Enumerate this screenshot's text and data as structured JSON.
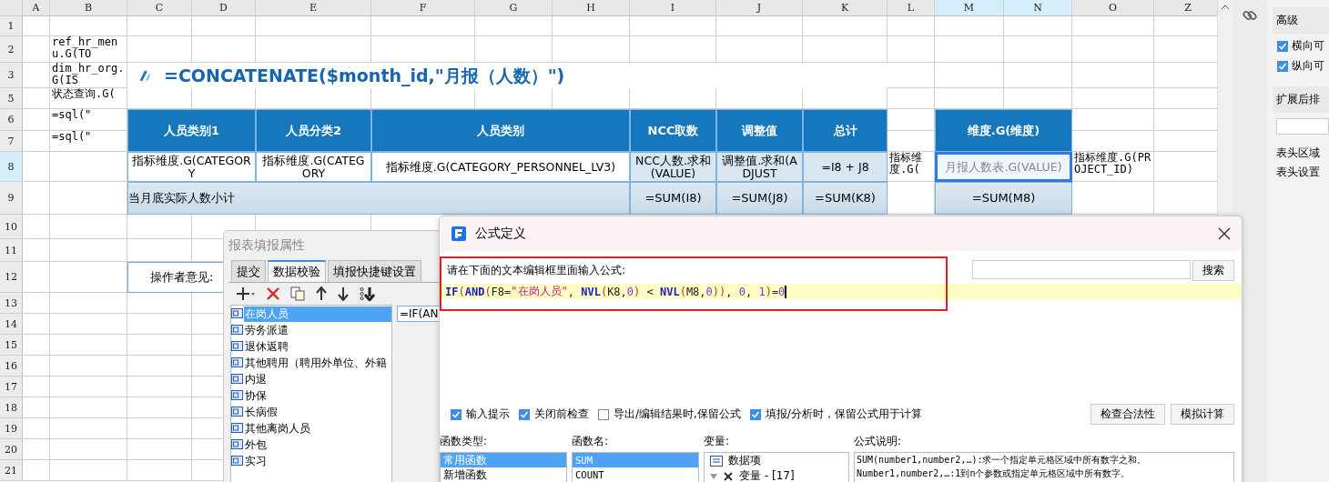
{
  "sheet": {
    "columns": [
      {
        "label": "A",
        "selected": false
      },
      {
        "label": "B",
        "selected": false
      },
      {
        "label": "C",
        "selected": false
      },
      {
        "label": "D",
        "selected": false
      },
      {
        "label": "E",
        "selected": false
      },
      {
        "label": "F",
        "selected": false
      },
      {
        "label": "G",
        "selected": false
      },
      {
        "label": "H",
        "selected": false
      },
      {
        "label": "I",
        "selected": false
      },
      {
        "label": "J",
        "selected": false
      },
      {
        "label": "K",
        "selected": false
      },
      {
        "label": "L",
        "selected": false
      },
      {
        "label": "M",
        "selected": true
      },
      {
        "label": "N",
        "selected": true
      },
      {
        "label": "O",
        "selected": false
      },
      {
        "label": "Z",
        "selected": false
      }
    ],
    "rows": [
      {
        "label": "1",
        "selected": false
      },
      {
        "label": "2",
        "selected": false
      },
      {
        "label": "3",
        "selected": false
      },
      {
        "label": "5",
        "selected": false
      },
      {
        "label": "6",
        "selected": false
      },
      {
        "label": "7",
        "selected": false
      },
      {
        "label": "8",
        "selected": true
      },
      {
        "label": "9",
        "selected": false
      },
      {
        "label": "10",
        "selected": false
      },
      {
        "label": "11",
        "selected": false
      },
      {
        "label": "12",
        "selected": false
      },
      {
        "label": "13",
        "selected": false
      },
      {
        "label": "14",
        "selected": false
      },
      {
        "label": "15",
        "selected": false
      },
      {
        "label": "16",
        "selected": false
      },
      {
        "label": "17",
        "selected": false
      },
      {
        "label": "18",
        "selected": false
      },
      {
        "label": "19",
        "selected": false
      },
      {
        "label": "20",
        "selected": false
      },
      {
        "label": "21",
        "selected": false
      }
    ],
    "cells": [
      {
        "kind": "code",
        "text": "ref_hr_menu.G(TO",
        "selected": false
      },
      {
        "kind": "code",
        "text": "dim_hr_org.G(IS",
        "selected": false
      },
      {
        "kind": "title",
        "text": "=CONCATENATE($month_id,\"月报（人数）\")",
        "selected": false
      },
      {
        "kind": "code",
        "text": "状态查询.G(",
        "selected": false
      },
      {
        "kind": "code",
        "text": "=sql(\"",
        "selected": false
      },
      {
        "kind": "code",
        "text": "=sql(\"",
        "selected": false
      },
      {
        "kind": "header",
        "text": "人员类别1",
        "selected": false
      },
      {
        "kind": "header",
        "text": "人员分类2",
        "selected": false
      },
      {
        "kind": "header",
        "text": "人员类别",
        "selected": false
      },
      {
        "kind": "header",
        "text": "NCC取数",
        "selected": false
      },
      {
        "kind": "header",
        "text": "调整值",
        "selected": false
      },
      {
        "kind": "header",
        "text": "总计",
        "selected": false
      },
      {
        "kind": "header",
        "text": "维度.G(维度)",
        "selected": false
      },
      {
        "kind": "data",
        "text": "指标维度.G(CATEGORY",
        "selected": false
      },
      {
        "kind": "data",
        "text": "指标维度.G(CATEGORY",
        "selected": false
      },
      {
        "kind": "data",
        "text": "指标维度.G(CATEGORY_PERSONNEL_LV3)",
        "selected": false
      },
      {
        "kind": "calc",
        "text": "NCC人数.求和(VALUE)",
        "selected": false
      },
      {
        "kind": "calc",
        "text": "调整值.求和(ADJUST",
        "selected": false
      },
      {
        "kind": "calc",
        "text": "=I8 + J8",
        "selected": false
      },
      {
        "kind": "code",
        "text": "指标维度.G(",
        "selected": false
      },
      {
        "kind": "calc",
        "text": "月报人数表.G(VALUE)",
        "selected": true
      },
      {
        "kind": "code",
        "text": "指标维度.G(PROJECT_ID)",
        "selected": false
      },
      {
        "kind": "subtotal_label",
        "text": "当月底实际人数小计",
        "selected": false
      },
      {
        "kind": "subtotal",
        "text": "=SUM(I8)",
        "selected": false
      },
      {
        "kind": "subtotal",
        "text": "=SUM(J8)",
        "selected": false
      },
      {
        "kind": "subtotal",
        "text": "=SUM(K8)",
        "selected": false
      },
      {
        "kind": "subtotal",
        "text": "=SUM(M8)",
        "selected": false
      },
      {
        "kind": "note",
        "text": "操作者意见:",
        "selected": false
      }
    ]
  },
  "side_panel": {
    "section": "高级",
    "checks": [
      {
        "label": "横向可",
        "checked": true
      },
      {
        "label": "纵向可",
        "checked": true
      }
    ],
    "section_2": "扩展后排",
    "labels": [
      "表头区域",
      "表头设置"
    ]
  },
  "fill_dialog": {
    "title": "报表填报属性",
    "tabs": [
      {
        "label": "提交",
        "selected": false
      },
      {
        "label": "数据校验",
        "selected": true
      },
      {
        "label": "填报快捷键设置",
        "selected": false
      }
    ],
    "items": [
      {
        "label": "在岗人员",
        "selected": true
      },
      {
        "label": "劳务派遣",
        "selected": false
      },
      {
        "label": "退休返聘",
        "selected": false
      },
      {
        "label": "其他聘用（聘用外单位、外籍",
        "selected": false
      },
      {
        "label": "内退",
        "selected": false
      },
      {
        "label": "协保",
        "selected": false
      },
      {
        "label": "长病假",
        "selected": false
      },
      {
        "label": "其他离岗人员",
        "selected": false
      },
      {
        "label": "外包",
        "selected": false
      },
      {
        "label": "实习",
        "selected": false
      }
    ],
    "formula_field": "=IF(AN"
  },
  "formula_dialog": {
    "title": "公式定义",
    "prompt": "请在下面的文本编辑框里面输入公式:",
    "search_button": "搜索",
    "tokens": [
      {
        "kind": "fn",
        "text": "IF"
      },
      {
        "kind": "paren",
        "text": "("
      },
      {
        "kind": "fn",
        "text": "AND"
      },
      {
        "kind": "paren",
        "text": "("
      },
      {
        "kind": "ref",
        "text": "F8="
      },
      {
        "kind": "str",
        "text": "\"在岗人员\""
      },
      {
        "kind": "ref",
        "text": ", "
      },
      {
        "kind": "fn",
        "text": "NVL"
      },
      {
        "kind": "paren",
        "text": "("
      },
      {
        "kind": "ref",
        "text": "K8,"
      },
      {
        "kind": "num",
        "text": "0"
      },
      {
        "kind": "paren",
        "text": ")"
      },
      {
        "kind": "ref",
        "text": " < "
      },
      {
        "kind": "fn",
        "text": "NVL"
      },
      {
        "kind": "paren",
        "text": "("
      },
      {
        "kind": "ref",
        "text": "M8,"
      },
      {
        "kind": "num",
        "text": "0"
      },
      {
        "kind": "paren",
        "text": "))"
      },
      {
        "kind": "ref",
        "text": ", "
      },
      {
        "kind": "num",
        "text": "0"
      },
      {
        "kind": "ref",
        "text": ", "
      },
      {
        "kind": "num",
        "text": "1"
      },
      {
        "kind": "paren",
        "text": ")"
      },
      {
        "kind": "ref",
        "text": "="
      },
      {
        "kind": "num",
        "text": "0"
      }
    ],
    "options": [
      {
        "label": "输入提示",
        "checked": true
      },
      {
        "label": "关闭前检查",
        "checked": true
      },
      {
        "label": "导出/编辑结果时,保留公式",
        "checked": false
      },
      {
        "label": "填报/分析时，保留公式用于计算",
        "checked": true
      }
    ],
    "buttons": [
      "检查合法性",
      "模拟计算"
    ],
    "function_types": {
      "heading": "函数类型:",
      "items": [
        {
          "label": "常用函数",
          "selected": true
        },
        {
          "label": "新增函数",
          "selected": false
        }
      ]
    },
    "function_names": {
      "heading": "函数名:",
      "items": [
        {
          "label": "SUM",
          "selected": true
        },
        {
          "label": "COUNT",
          "selected": false
        }
      ]
    },
    "variables": {
      "heading": "变量:",
      "items": [
        {
          "kind": "data",
          "label": "数据项"
        },
        {
          "kind": "variable",
          "label": "变量 - [17]"
        }
      ]
    },
    "description": {
      "heading": "公式说明:",
      "lines": [
        "SUM(number1,number2,…):求一个指定单元格区域中所有数字之和。",
        "Number1,number2,…:1到n个参数或指定单元格区域中所有数字。"
      ]
    }
  }
}
